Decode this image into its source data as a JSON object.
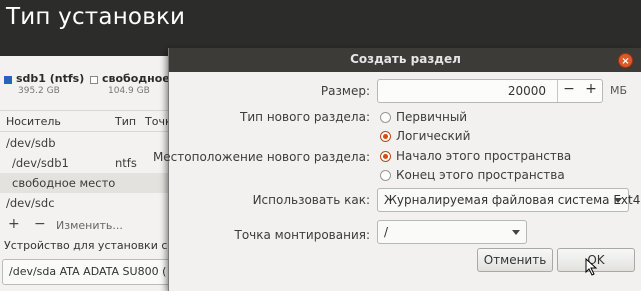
{
  "installer": {
    "title": "Тип установки",
    "legend": {
      "ntfs_label": "sdb1 (ntfs)",
      "ntfs_size": "395.2 GB",
      "free_label": "свободное",
      "free_size": "104.9 GB"
    },
    "table": {
      "headers": [
        "Носитель",
        "Тип",
        "Точк"
      ],
      "rows": [
        {
          "device": "/dev/sdb",
          "type": ""
        },
        {
          "device": "/dev/sdb1",
          "type": "ntfs"
        },
        {
          "device": "свободное место",
          "type": ""
        },
        {
          "device": "/dev/sdc",
          "type": ""
        }
      ]
    },
    "toolbar": {
      "add": "+",
      "remove": "−",
      "change": "Изменить..."
    },
    "boot_label": "Устройство для установки сис",
    "boot_value": "/dev/sda   ATA ADATA SU800 ("
  },
  "dialog": {
    "title": "Создать раздел",
    "close": "×",
    "size_label": "Размер:",
    "size_value": "20000",
    "size_minus": "−",
    "size_plus": "+",
    "size_unit": "МБ",
    "type_label": "Тип нового раздела:",
    "type_primary": "Первичный",
    "type_logical": "Логический",
    "location_label": "Местоположение нового раздела:",
    "location_start": "Начало этого пространства",
    "location_end": "Конец этого пространства",
    "use_as_label": "Использовать как:",
    "use_as_value": "Журналируемая файловая система Ext4",
    "mount_label": "Точка монтирования:",
    "mount_value": "/",
    "cancel": "Отменить",
    "ok": "OK",
    "selected_type": "logical",
    "selected_location": "start"
  },
  "colors": {
    "accent": "#dd4814",
    "titlebar": "#3c3b37",
    "ntfs": "#2a62b8"
  }
}
